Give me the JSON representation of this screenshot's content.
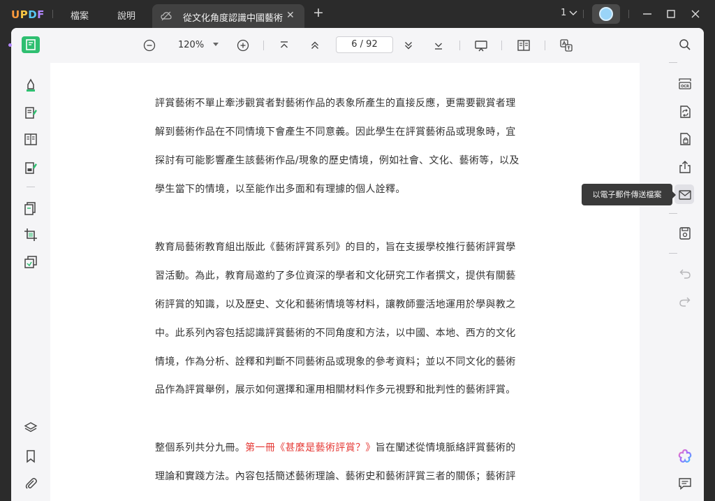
{
  "app": {
    "logo": "UPDF",
    "menu": [
      "檔案",
      "說明"
    ]
  },
  "tab": {
    "title": "從文化角度認識中國藝術"
  },
  "pages": {
    "count": "1"
  },
  "toolbar": {
    "zoom": "120%",
    "page_current": "6",
    "page_total": "92",
    "page_display": "6 / 92"
  },
  "tooltip": {
    "email": "以電子郵件傳送檔案"
  },
  "document": {
    "lines": [
      "評賞藝術不單止牽涉觀賞者對藝術作品的表象所產生的直接反應，更需要觀賞者理",
      "解到藝術作品在不同情境下會產生不同意義。因此學生在評賞藝術品或現象時，宜",
      "探討有可能影響產生該藝術作品/現象的歷史情境，例如社會、文化、藝術等，以及",
      "學生當下的情境，以至能作出多面和有理據的個人詮釋。",
      "教育局藝術教育組出版此《藝術評賞系列》的目的，旨在支援學校推行藝術評賞學",
      "習活動。為此，教育局邀約了多位資深的學者和文化研究工作者撰文，提供有關藝",
      "術評賞的知識，以及歷史、文化和藝術情境等材料，讓教師靈活地運用於學與教之",
      "中。此系列內容包括認識評賞藝術的不同角度和方法，以中國、本地、西方的文化",
      "情境，作為分析、詮釋和判斷不同藝術品或現象的參考資料；並以不同文化的藝術",
      "品作為評賞舉例，展示如何選擇和運用相關材料作多元視野和批判性的藝術評賞。"
    ],
    "line12_before": "整個系列共分九冊。",
    "line12_link": "第一冊《甚麼是藝術評賞？》",
    "line12_after": "旨在闡述從情境脈絡評賞藝術的",
    "line13": "理論和實踐方法。內容包括簡述藝術理論、藝術史和藝術評賞三者的關係；藝術評"
  },
  "colors": {
    "accent": "#2fbf71",
    "link_red": "#e53935"
  }
}
